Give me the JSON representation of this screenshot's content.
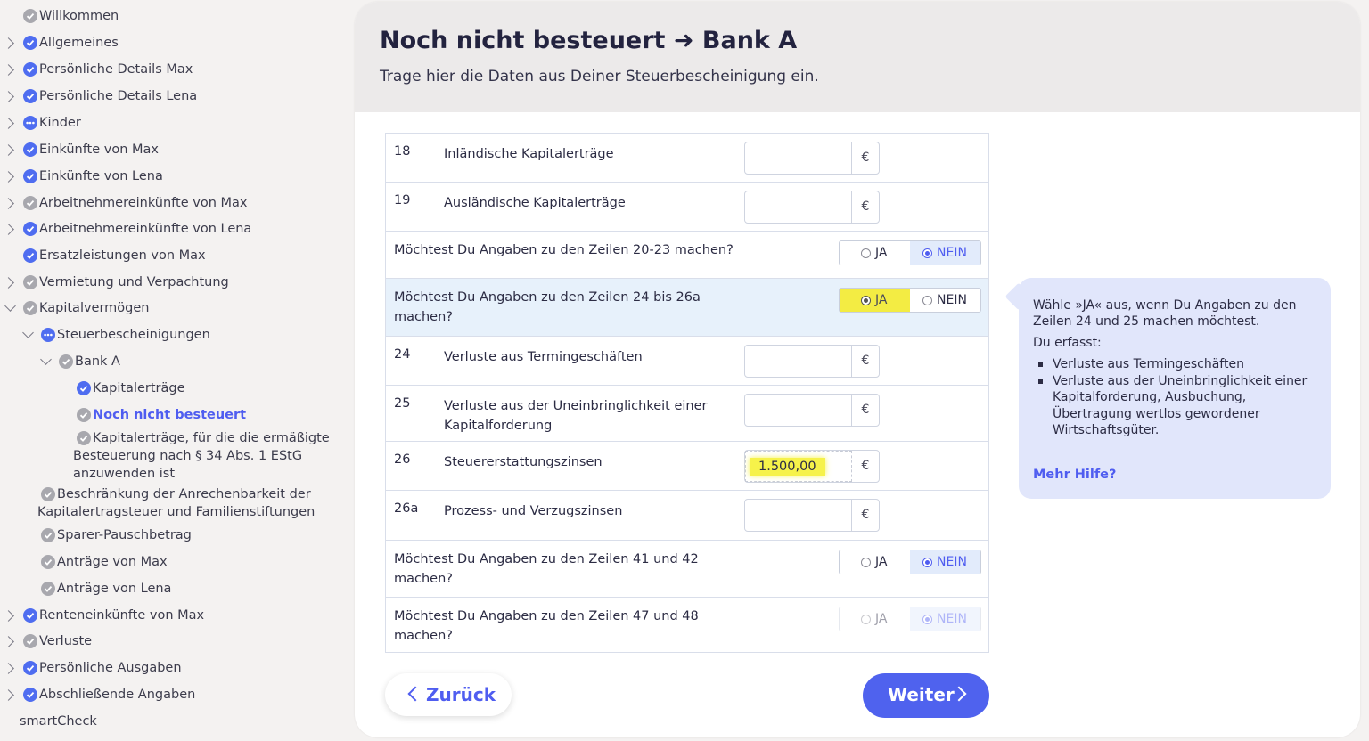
{
  "sidebar": {
    "items": [
      {
        "label": "Willkommen",
        "status": "gray",
        "expand": "none"
      },
      {
        "label": "Allgemeines",
        "status": "blue",
        "expand": "right"
      },
      {
        "label": "Persönliche Details Max",
        "status": "blue",
        "expand": "right"
      },
      {
        "label": "Persönliche Details Lena",
        "status": "blue",
        "expand": "right"
      },
      {
        "label": "Kinder",
        "status": "blue-dots",
        "expand": "right"
      },
      {
        "label": "Einkünfte von Max",
        "status": "blue",
        "expand": "right"
      },
      {
        "label": "Einkünfte von Lena",
        "status": "blue",
        "expand": "right"
      },
      {
        "label": "Arbeitnehmereinkünfte von Max",
        "status": "gray",
        "expand": "right"
      },
      {
        "label": "Arbeitnehmereinkünfte von Lena",
        "status": "blue",
        "expand": "right"
      },
      {
        "label": "Ersatzleistungen von Max",
        "status": "blue",
        "expand": "none"
      },
      {
        "label": "Vermietung und Verpachtung",
        "status": "gray",
        "expand": "right"
      },
      {
        "label": "Kapitalvermögen",
        "status": "gray",
        "expand": "down"
      },
      {
        "label": "Steuerbescheinigungen",
        "status": "blue-dots",
        "expand": "down"
      },
      {
        "label": "Bank A",
        "status": "gray",
        "expand": "down"
      },
      {
        "label": "Kapitalerträge",
        "status": "blue",
        "expand": "none"
      },
      {
        "label": "Noch nicht besteuert",
        "status": "gray",
        "expand": "none"
      },
      {
        "label": "Kapitalerträge, für die die ermäßigte Besteuerung nach § 34 Abs. 1 EStG anzuwenden ist",
        "status": "gray",
        "expand": "none"
      },
      {
        "label": "Beschränkung der Anrechenbarkeit der Kapitalertragsteuer und Familienstiftungen",
        "status": "gray",
        "expand": "none"
      },
      {
        "label": "Sparer-Pauschbetrag",
        "status": "gray",
        "expand": "none"
      },
      {
        "label": "Anträge von Max",
        "status": "gray",
        "expand": "none"
      },
      {
        "label": "Anträge von Lena",
        "status": "gray",
        "expand": "none"
      },
      {
        "label": "Renteneinkünfte von Max",
        "status": "blue",
        "expand": "right"
      },
      {
        "label": "Verluste",
        "status": "gray",
        "expand": "right"
      },
      {
        "label": "Persönliche Ausgaben",
        "status": "blue",
        "expand": "right"
      },
      {
        "label": "Abschließende Angaben",
        "status": "blue",
        "expand": "right"
      },
      {
        "label": "smartCheck",
        "status": "none",
        "expand": "none"
      }
    ]
  },
  "header": {
    "title": "Noch nicht besteuert ➜ Bank A",
    "subtitle": "Trage hier die Daten aus Deiner Steuerbescheinigung ein."
  },
  "form": {
    "currency": "€",
    "yes": "JA",
    "no": "NEIN",
    "rows": [
      {
        "num": "18",
        "label": "Inländische Kapitalerträge",
        "value": ""
      },
      {
        "num": "19",
        "label": "Ausländische Kapitalerträge",
        "value": ""
      },
      {
        "question": "Möchtest Du Angaben zu den Zeilen 20-23 machen?",
        "selected": "NEIN"
      },
      {
        "question": "Möchtest Du Angaben zu den Zeilen 24 bis 26a machen?",
        "selected": "JA"
      },
      {
        "num": "24",
        "label": "Verluste aus Termingeschäften",
        "value": ""
      },
      {
        "num": "25",
        "label": "Verluste aus der Uneinbringlichkeit einer Kapitalforderung",
        "value": ""
      },
      {
        "num": "26",
        "label": "Steuererstattungszinsen",
        "value": "1.500,00"
      },
      {
        "num": "26a",
        "label": "Prozess- und Verzugszinsen",
        "value": ""
      },
      {
        "question": "Möchtest Du Angaben zu den Zeilen 41 und 42 machen?",
        "selected": "NEIN"
      },
      {
        "question": "Möchtest Du Angaben zu den Zeilen 47 und 48 machen?",
        "selected": "NEIN",
        "disabled": true
      }
    ]
  },
  "help": {
    "intro": "Wähle »JA« aus, wenn Du Angaben zu den Zeilen 24 und 25 machen möchtest.",
    "lead": "Du erfasst:",
    "bullets": [
      "Verluste aus Termingeschäften",
      "Verluste aus der Uneinbringlichkeit einer Kapitalforderung, Ausbuchung, Übertragung wertlos gewordener Wirtschaftsgüter."
    ],
    "more": "Mehr Hilfe?"
  },
  "buttons": {
    "back": "Zurück",
    "next": "Weiter"
  },
  "colors": {
    "accent": "#4f5df0",
    "highlight": "#f6f24a",
    "help_bg": "#e1e6fb"
  }
}
